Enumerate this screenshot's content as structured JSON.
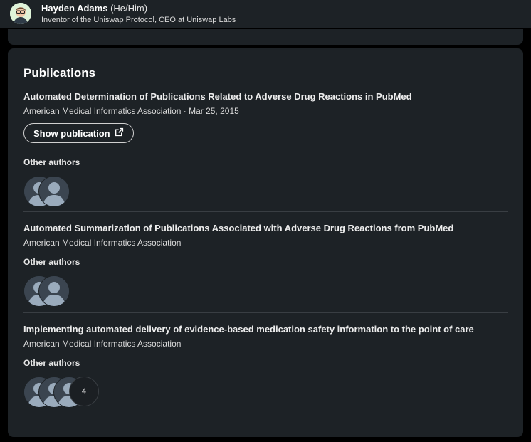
{
  "header": {
    "name": "Hayden Adams",
    "pronouns": "(He/Him)",
    "headline": "Inventor of the Uniswap Protocol, CEO at Uniswap Labs"
  },
  "section": {
    "title": "Publications"
  },
  "publications": [
    {
      "title": "Automated Determination of Publications Related to Adverse Drug Reactions in PubMed",
      "meta": "American Medical Informatics Association · Mar 25, 2015",
      "button_label": "Show publication",
      "other_authors_label": "Other authors"
    },
    {
      "title": "Automated Summarization of Publications Associated with Adverse Drug Reactions from PubMed",
      "meta": "American Medical Informatics Association",
      "other_authors_label": "Other authors"
    },
    {
      "title": "Implementing automated delivery of evidence-based medication safety information to the point of care",
      "meta": "American Medical Informatics Association",
      "other_authors_label": "Other authors",
      "more_authors_count": "4"
    }
  ],
  "icons": {
    "external_link": "external-link-icon",
    "avatar_placeholder": "person-icon"
  },
  "colors": {
    "background": "#000000",
    "card": "#1d2226",
    "text": "#e9e9e9"
  }
}
